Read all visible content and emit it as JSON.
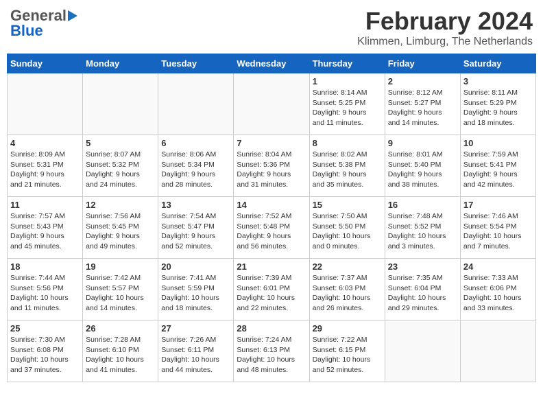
{
  "header": {
    "logo_general": "General",
    "logo_blue": "Blue",
    "month_year": "February 2024",
    "location": "Klimmen, Limburg, The Netherlands"
  },
  "weekdays": [
    "Sunday",
    "Monday",
    "Tuesday",
    "Wednesday",
    "Thursday",
    "Friday",
    "Saturday"
  ],
  "weeks": [
    [
      {
        "day": "",
        "info": ""
      },
      {
        "day": "",
        "info": ""
      },
      {
        "day": "",
        "info": ""
      },
      {
        "day": "",
        "info": ""
      },
      {
        "day": "1",
        "info": "Sunrise: 8:14 AM\nSunset: 5:25 PM\nDaylight: 9 hours\nand 11 minutes."
      },
      {
        "day": "2",
        "info": "Sunrise: 8:12 AM\nSunset: 5:27 PM\nDaylight: 9 hours\nand 14 minutes."
      },
      {
        "day": "3",
        "info": "Sunrise: 8:11 AM\nSunset: 5:29 PM\nDaylight: 9 hours\nand 18 minutes."
      }
    ],
    [
      {
        "day": "4",
        "info": "Sunrise: 8:09 AM\nSunset: 5:31 PM\nDaylight: 9 hours\nand 21 minutes."
      },
      {
        "day": "5",
        "info": "Sunrise: 8:07 AM\nSunset: 5:32 PM\nDaylight: 9 hours\nand 24 minutes."
      },
      {
        "day": "6",
        "info": "Sunrise: 8:06 AM\nSunset: 5:34 PM\nDaylight: 9 hours\nand 28 minutes."
      },
      {
        "day": "7",
        "info": "Sunrise: 8:04 AM\nSunset: 5:36 PM\nDaylight: 9 hours\nand 31 minutes."
      },
      {
        "day": "8",
        "info": "Sunrise: 8:02 AM\nSunset: 5:38 PM\nDaylight: 9 hours\nand 35 minutes."
      },
      {
        "day": "9",
        "info": "Sunrise: 8:01 AM\nSunset: 5:40 PM\nDaylight: 9 hours\nand 38 minutes."
      },
      {
        "day": "10",
        "info": "Sunrise: 7:59 AM\nSunset: 5:41 PM\nDaylight: 9 hours\nand 42 minutes."
      }
    ],
    [
      {
        "day": "11",
        "info": "Sunrise: 7:57 AM\nSunset: 5:43 PM\nDaylight: 9 hours\nand 45 minutes."
      },
      {
        "day": "12",
        "info": "Sunrise: 7:56 AM\nSunset: 5:45 PM\nDaylight: 9 hours\nand 49 minutes."
      },
      {
        "day": "13",
        "info": "Sunrise: 7:54 AM\nSunset: 5:47 PM\nDaylight: 9 hours\nand 52 minutes."
      },
      {
        "day": "14",
        "info": "Sunrise: 7:52 AM\nSunset: 5:48 PM\nDaylight: 9 hours\nand 56 minutes."
      },
      {
        "day": "15",
        "info": "Sunrise: 7:50 AM\nSunset: 5:50 PM\nDaylight: 10 hours\nand 0 minutes."
      },
      {
        "day": "16",
        "info": "Sunrise: 7:48 AM\nSunset: 5:52 PM\nDaylight: 10 hours\nand 3 minutes."
      },
      {
        "day": "17",
        "info": "Sunrise: 7:46 AM\nSunset: 5:54 PM\nDaylight: 10 hours\nand 7 minutes."
      }
    ],
    [
      {
        "day": "18",
        "info": "Sunrise: 7:44 AM\nSunset: 5:56 PM\nDaylight: 10 hours\nand 11 minutes."
      },
      {
        "day": "19",
        "info": "Sunrise: 7:42 AM\nSunset: 5:57 PM\nDaylight: 10 hours\nand 14 minutes."
      },
      {
        "day": "20",
        "info": "Sunrise: 7:41 AM\nSunset: 5:59 PM\nDaylight: 10 hours\nand 18 minutes."
      },
      {
        "day": "21",
        "info": "Sunrise: 7:39 AM\nSunset: 6:01 PM\nDaylight: 10 hours\nand 22 minutes."
      },
      {
        "day": "22",
        "info": "Sunrise: 7:37 AM\nSunset: 6:03 PM\nDaylight: 10 hours\nand 26 minutes."
      },
      {
        "day": "23",
        "info": "Sunrise: 7:35 AM\nSunset: 6:04 PM\nDaylight: 10 hours\nand 29 minutes."
      },
      {
        "day": "24",
        "info": "Sunrise: 7:33 AM\nSunset: 6:06 PM\nDaylight: 10 hours\nand 33 minutes."
      }
    ],
    [
      {
        "day": "25",
        "info": "Sunrise: 7:30 AM\nSunset: 6:08 PM\nDaylight: 10 hours\nand 37 minutes."
      },
      {
        "day": "26",
        "info": "Sunrise: 7:28 AM\nSunset: 6:10 PM\nDaylight: 10 hours\nand 41 minutes."
      },
      {
        "day": "27",
        "info": "Sunrise: 7:26 AM\nSunset: 6:11 PM\nDaylight: 10 hours\nand 44 minutes."
      },
      {
        "day": "28",
        "info": "Sunrise: 7:24 AM\nSunset: 6:13 PM\nDaylight: 10 hours\nand 48 minutes."
      },
      {
        "day": "29",
        "info": "Sunrise: 7:22 AM\nSunset: 6:15 PM\nDaylight: 10 hours\nand 52 minutes."
      },
      {
        "day": "",
        "info": ""
      },
      {
        "day": "",
        "info": ""
      }
    ]
  ]
}
